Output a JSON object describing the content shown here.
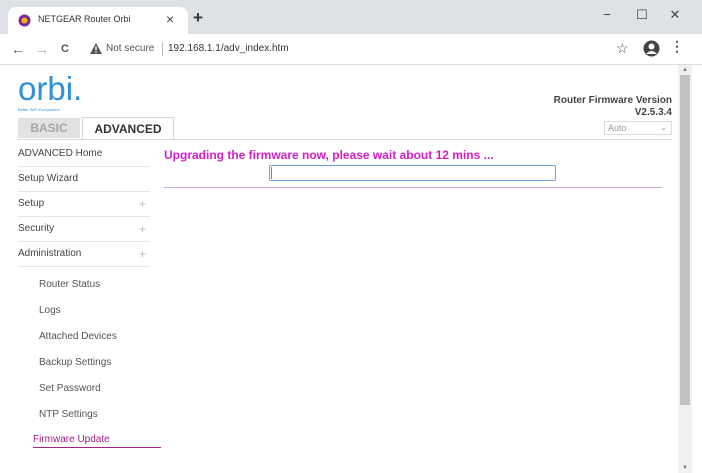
{
  "browser": {
    "tab_title": "NETGEAR Router Orbi",
    "tab_close": "×",
    "new_tab": "+",
    "window_controls": {
      "minimize": "−",
      "maximize": "☐",
      "close": "✕"
    },
    "nav": {
      "back": "←",
      "forward": "→",
      "reload": "C"
    },
    "address": {
      "security_label": "Not secure",
      "url": "192.168.1.1/adv_index.htm"
    },
    "icons": [
      "back-arrow-icon",
      "forward-arrow-icon",
      "reload-icon",
      "warning-icon",
      "star-icon",
      "account-icon",
      "kebab-menu-icon"
    ]
  },
  "header": {
    "logo_text": "orbi.",
    "logo_tagline": "Better WiFi Everywhere",
    "firmware_label": "Router Firmware Version",
    "firmware_version": "V2.5.3.4",
    "language_select": "Auto"
  },
  "tabs": {
    "basic": "BASIC",
    "advanced": "ADVANCED"
  },
  "sidebar": {
    "items": [
      {
        "label": "ADVANCED Home",
        "expandable": false
      },
      {
        "label": "Setup Wizard",
        "expandable": false
      },
      {
        "label": "Setup",
        "expandable": true,
        "expander": "+"
      },
      {
        "label": "Security",
        "expandable": true,
        "expander": "+"
      },
      {
        "label": "Administration",
        "expandable": true,
        "expander": "+"
      }
    ],
    "admin_subitems": [
      "Router Status",
      "Logs",
      "Attached Devices",
      "Backup Settings",
      "Set Password",
      "NTP Settings",
      "Firmware Update"
    ],
    "active_subitem": "Firmware Update"
  },
  "main": {
    "message": "Upgrading the firmware now, please wait about 12 mins ...",
    "progress_fraction": 0.003
  },
  "colors": {
    "accent_magenta": "#d11fc6",
    "active_link": "#a0208c",
    "logo_blue": "#2f8fd8"
  }
}
